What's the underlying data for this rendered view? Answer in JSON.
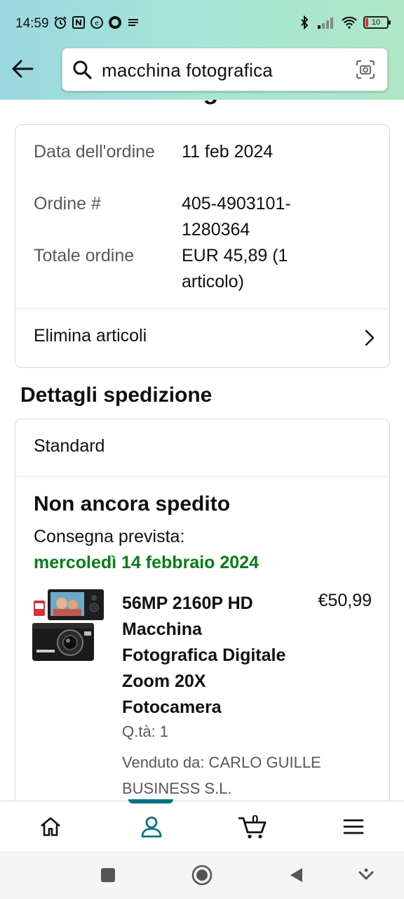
{
  "status_bar": {
    "time": "14:59",
    "battery": "10",
    "left_icons": [
      "alarm-icon",
      "nfc-icon",
      "app-icon",
      "circle-icon",
      "notification-icon"
    ],
    "right_icons": [
      "bluetooth-icon",
      "signal-icon",
      "wifi-icon",
      "battery-icon"
    ]
  },
  "search": {
    "query": "macchina fotografica"
  },
  "page": {
    "title": "Visualizza dettagli ordine"
  },
  "order_summary": {
    "rows": [
      {
        "label": "Data dell'ordine",
        "value": "11 feb 2024"
      },
      {
        "label": "Ordine #",
        "value": "405-4903101-1280364"
      },
      {
        "label": "Totale ordine",
        "value": "EUR 45,89 (1 articolo)"
      }
    ],
    "remove_items_label": "Elimina articoli"
  },
  "shipping": {
    "section_title": "Dettagli spedizione",
    "method": "Standard",
    "status": "Non ancora spedito",
    "delivery_label": "Consegna prevista:",
    "delivery_date": "mercoledì 14 febbraio 2024",
    "product": {
      "title": "56MP 2160P HD Macchina Fotografica Digitale Zoom 20X Fotocamera",
      "price": "€50,99",
      "quantity": "Q.tà: 1",
      "seller": "Venduto da: CARLO GUILLE BUSINESS S.L."
    }
  },
  "bottom_nav": {
    "cart_count": "0",
    "items": [
      "home-icon",
      "account-icon",
      "cart-icon",
      "menu-icon"
    ],
    "active_index": 1
  },
  "colors": {
    "accent": "#007185",
    "delivery_green": "#067d19",
    "header_gradient_start": "#9ad8e0",
    "header_gradient_end": "#aee8c6"
  }
}
